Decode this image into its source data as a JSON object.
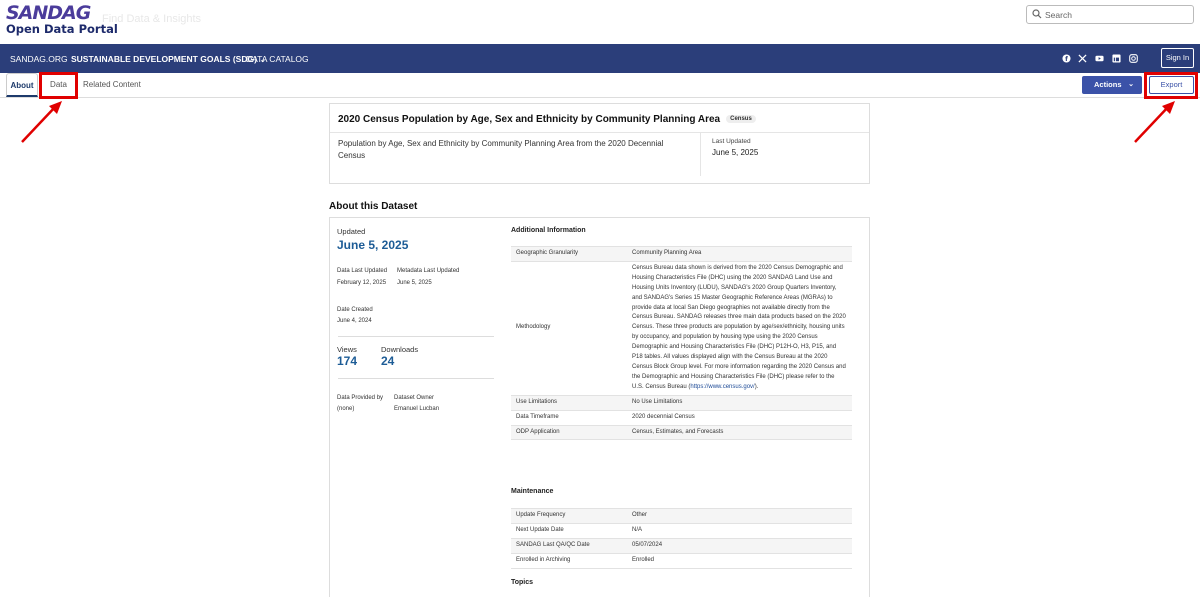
{
  "header": {
    "logo_title": "SANDAG",
    "logo_subtitle": "Open Data Portal",
    "logo_ghost_text": "Find Data & Insights",
    "search_placeholder": "Search"
  },
  "nav": {
    "items": [
      {
        "label": "SANDAG.ORG"
      },
      {
        "label": "SUSTAINABLE DEVELOPMENT GOALS (SDG)"
      },
      {
        "label": "DATA CATALOG"
      }
    ],
    "social_icons": [
      "facebook-icon",
      "x-icon",
      "youtube-icon",
      "linkedin-icon",
      "instagram-icon"
    ],
    "sign_in_label": "Sign In"
  },
  "tabs": {
    "about": "About",
    "data": "Data",
    "related": "Related Content",
    "actions_label": "Actions",
    "export_label": "Export"
  },
  "dataset": {
    "title": "2020 Census Population by Age, Sex and Ethnicity by Community Planning Area",
    "tag": "Census",
    "description": "Population by Age, Sex and Ethnicity by Community Planning Area from the 2020 Decennial Census",
    "last_updated_label": "Last Updated",
    "last_updated": "June 5, 2025"
  },
  "about": {
    "section_title": "About this Dataset",
    "updated_label": "Updated",
    "updated_value": "June 5, 2025",
    "data_last_updated_label": "Data Last Updated",
    "data_last_updated": "February 12, 2025",
    "metadata_last_updated_label": "Metadata Last Updated",
    "metadata_last_updated": "June 5, 2025",
    "date_created_label": "Date Created",
    "date_created": "June 4, 2024",
    "views_label": "Views",
    "views": "174",
    "downloads_label": "Downloads",
    "downloads": "24",
    "provided_by_label": "Data Provided by",
    "provided_by": "(none)",
    "owner_label": "Dataset Owner",
    "owner": "Emanuel Lucban"
  },
  "additional_info": {
    "heading": "Additional Information",
    "geo_key": "Geographic Granularity",
    "geo_val": "Community Planning Area",
    "method_key": "Methodology",
    "method_val": "Census Bureau data shown is derived from the 2020 Census Demographic and Housing Characteristics File (DHC) using the 2020 SANDAG Land Use and Housing Units Inventory (LUDU), SANDAG's 2020 Group Quarters Inventory, and SANDAG's Series 15 Master Geographic Reference Areas (MGRAs) to provide data at local San Diego geographies not available directly from the Census Bureau. SANDAG releases three main data products based on the 2020 Census. These three products are population by age/sex/ethnicity, housing units by occupancy, and population by housing type using the 2020 Census Demographic and Housing Characteristics File (DHC) P12H-O, H3, P15, and P18 tables. All values displayed align with the Census Bureau at the 2020 Census Block Group level. For more information regarding the 2020 Census and the Demographic and Housing Characteristics File (DHC) please refer to the U.S. Census Bureau (",
    "method_link": "https://www.census.gov/",
    "method_end": ").",
    "use_key": "Use Limitations",
    "use_val": "No Use Limitations",
    "timeframe_key": "Data Timeframe",
    "timeframe_val": "2020 decennial Census",
    "odp_key": "ODP Application",
    "odp_val": "Census, Estimates, and Forecasts"
  },
  "maintenance": {
    "heading": "Maintenance",
    "freq_key": "Update Frequency",
    "freq_val": "Other",
    "next_key": "Next Update Date",
    "next_val": "N/A",
    "qa_key": "SANDAG Last QA/QC Date",
    "qa_val": "05/07/2024",
    "arch_key": "Enrolled in Archiving",
    "arch_val": "Enrolled"
  },
  "topics": {
    "heading": "Topics"
  },
  "colors": {
    "navbar": "#2b3e7a",
    "accent": "#3b52a8",
    "highlight": "#e00000",
    "link": "#1d5c96"
  }
}
